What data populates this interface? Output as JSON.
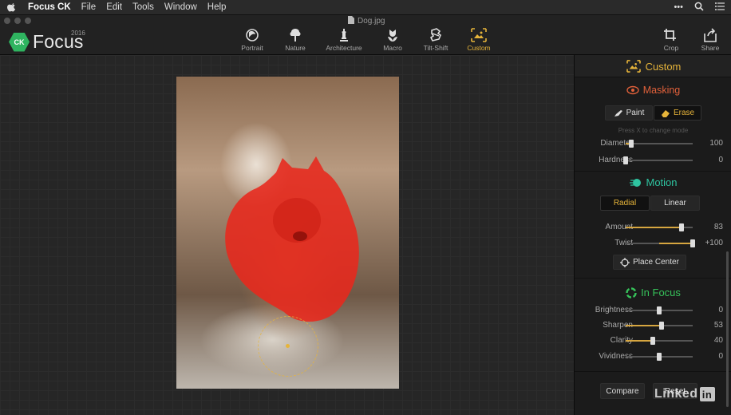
{
  "menubar": {
    "app": "Focus CK",
    "items": [
      "File",
      "Edit",
      "Tools",
      "Window",
      "Help"
    ],
    "more": "•••"
  },
  "document": {
    "title": "Dog.jpg"
  },
  "logo": {
    "badge": "CK",
    "name": "Focus",
    "year": "2016"
  },
  "toolbar": {
    "modes": [
      {
        "label": "Portrait",
        "icon": "portrait-icon"
      },
      {
        "label": "Nature",
        "icon": "tree-icon"
      },
      {
        "label": "Architecture",
        "icon": "statue-icon"
      },
      {
        "label": "Macro",
        "icon": "flower-icon"
      },
      {
        "label": "Tilt-Shift",
        "icon": "tilt-shift-icon"
      },
      {
        "label": "Custom",
        "icon": "custom-icon",
        "active": true
      }
    ],
    "crop": "Crop",
    "share": "Share"
  },
  "panel": {
    "header": "Custom",
    "masking": {
      "title": "Masking",
      "paint": "Paint",
      "erase": "Erase",
      "hint": "Press X to change mode",
      "diameter": {
        "label": "Diameter",
        "value": "100",
        "level": 0.08
      },
      "hardness": {
        "label": "Hardness",
        "value": "0",
        "level": 0.0
      }
    },
    "motion": {
      "title": "Motion",
      "radial": "Radial",
      "linear": "Linear",
      "amount": {
        "label": "Amount",
        "value": "83",
        "level": 0.83
      },
      "twist": {
        "label": "Twist",
        "value": "+100",
        "level": 1.0,
        "bipolar": true
      },
      "place_center": "Place Center"
    },
    "in_focus": {
      "title": "In Focus",
      "brightness": {
        "label": "Brightness",
        "value": "0",
        "level": 0.5,
        "bipolar": true
      },
      "sharpen": {
        "label": "Sharpen",
        "value": "53",
        "level": 0.53
      },
      "clarity": {
        "label": "Clarity",
        "value": "40",
        "level": 0.4
      },
      "vividness": {
        "label": "Vividness",
        "value": "0",
        "level": 0.5,
        "bipolar": true
      }
    },
    "compare": "Compare",
    "reset": "Reset"
  },
  "watermark": {
    "text": "Linked",
    "badge": "in"
  },
  "colors": {
    "accent": "#e6b43a",
    "masking": "#e0603a",
    "motion": "#2ec4a0",
    "in_focus": "#36c25a",
    "logo": "#2fb460"
  }
}
